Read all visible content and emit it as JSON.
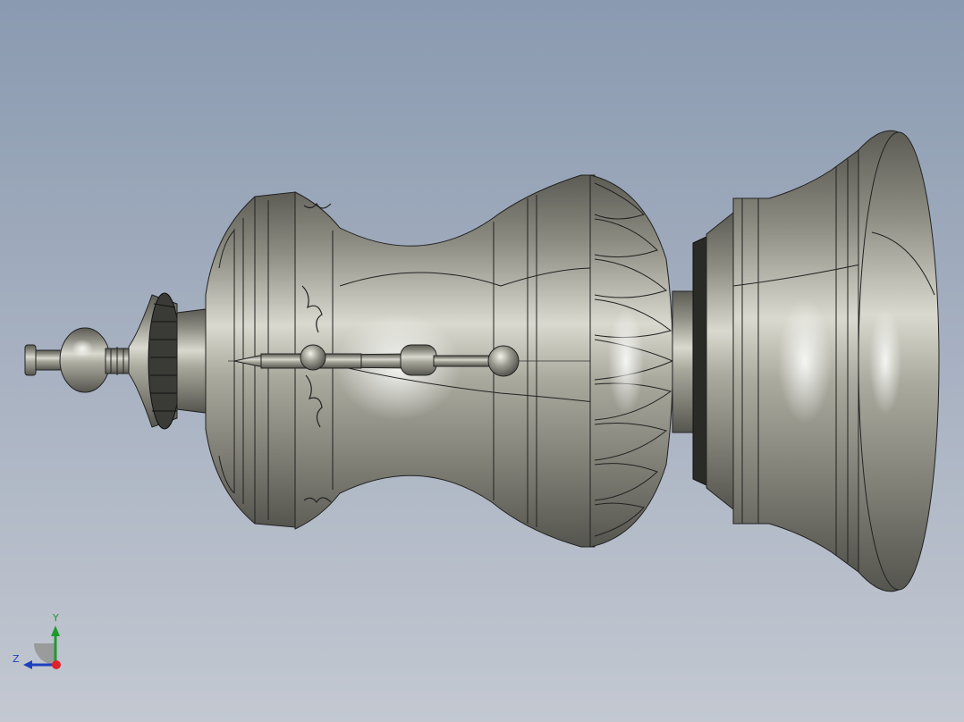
{
  "viewport": {
    "background_top": "#8a9ab0",
    "background_bottom": "#c3c8d1"
  },
  "model": {
    "description_icon": "pawn-vase-3d-model",
    "body_color": "#8f8f85",
    "edge_color": "#1e1e1e"
  },
  "triad": {
    "y_label": "Y",
    "z_label": "Z",
    "y_color": "#1f9a2e",
    "z_color": "#1d3fbf",
    "x_color": "#e0202a"
  }
}
